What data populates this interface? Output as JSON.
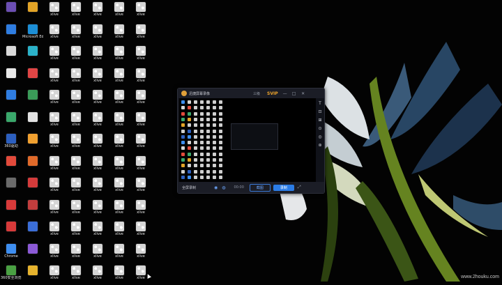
{
  "desktop": {
    "icons": [
      {
        "label": "",
        "color": "#6c4fb3"
      },
      {
        "label": "",
        "color": "#2f7de1"
      },
      {
        "label": "",
        "color": "#d9d9d9"
      },
      {
        "label": "",
        "color": "#e8e8e8"
      },
      {
        "label": "",
        "color": "#2f7de1"
      },
      {
        "label": "",
        "color": "#3aa86b"
      },
      {
        "label": "360驱动",
        "color": "#2c5fbf"
      },
      {
        "label": "",
        "color": "#e24a3b"
      },
      {
        "label": "",
        "color": "#6b6b6b"
      },
      {
        "label": "",
        "color": "#d73a3a"
      },
      {
        "label": "",
        "color": "#d73a3a"
      },
      {
        "label": "Chrome",
        "color": "#3e8ef0"
      },
      {
        "label": "360安全浏览器",
        "color": "#4aa143"
      },
      {
        "label": "",
        "color": "#e2a427"
      },
      {
        "label": "Microsoft Edge",
        "color": "#1c8ed6"
      },
      {
        "label": "",
        "color": "#2bb2c9"
      },
      {
        "label": "",
        "color": "#e04545"
      },
      {
        "label": "",
        "color": "#3a9b58"
      },
      {
        "label": "",
        "color": "#e2e2e2"
      },
      {
        "label": "",
        "color": "#f0a030"
      },
      {
        "label": "",
        "color": "#e06a2a"
      },
      {
        "label": "",
        "color": "#d43b3b"
      },
      {
        "label": "",
        "color": "#c23d3d"
      },
      {
        "label": "",
        "color": "#3b6ed8"
      },
      {
        "label": "",
        "color": "#8c5ad6"
      },
      {
        "label": "",
        "color": "#e6b32e"
      },
      {
        "label": "",
        "color": "#3b82d8"
      },
      {
        "label": "",
        "color": "#cccccc"
      },
      {
        "label": "",
        "color": "#3fae5a"
      },
      {
        "label": "",
        "color": "#3a6ccd"
      },
      {
        "label": "",
        "color": "#e54242"
      },
      {
        "label": "",
        "color": "#2b4fae"
      },
      {
        "label": "",
        "color": "#2fa84f"
      },
      {
        "label": "",
        "color": "#e9e9e9"
      }
    ],
    "xlive_label": "xlive"
  },
  "recorder": {
    "app_name": "迅捷屏幕录像",
    "menu": "三级",
    "vip": "SVIP",
    "title_buttons": [
      "—",
      "□",
      "✕"
    ],
    "side_tools": [
      "T",
      "⊡",
      "⊞",
      "⊙",
      "◎",
      "⊛"
    ],
    "screen_selector": "全屏录制",
    "timer": "00:00",
    "cut_label": "截图",
    "record_label": "录制",
    "expand": "⤢"
  },
  "watermark": "www.2houku.com",
  "colors": {
    "accent": "#2b7ce6",
    "vip": "#f0a62b",
    "window_bg": "#15171e"
  }
}
